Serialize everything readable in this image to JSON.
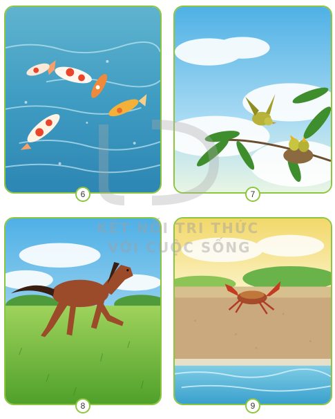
{
  "cards": [
    {
      "number": "6",
      "subject": "koi-fish"
    },
    {
      "number": "7",
      "subject": "birds-nest"
    },
    {
      "number": "8",
      "subject": "horse"
    },
    {
      "number": "9",
      "subject": "crab"
    }
  ],
  "watermark": {
    "line1": "KẾT NỐI TRI THỨC",
    "line2": "VỚI CUỘC SỐNG"
  },
  "colors": {
    "border": "#8cc63f",
    "water": "#4aa6c8",
    "sky": "#7cc3ea",
    "grass": "#7cc242",
    "sand": "#c9a97d"
  }
}
